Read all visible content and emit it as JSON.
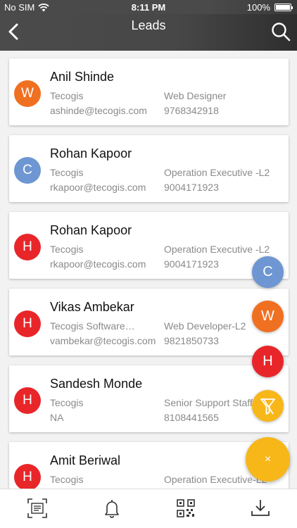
{
  "status_bar": {
    "carrier": "No SIM",
    "time": "8:11 PM",
    "battery": "100%"
  },
  "nav": {
    "title": "Leads",
    "back_icon": "chevron-left-icon",
    "search_icon": "search-icon"
  },
  "leads": [
    {
      "initial": "W",
      "color": "#f07022",
      "name": "Anil Shinde",
      "company": "Tecogis",
      "role": "Web Designer",
      "email": "ashinde@tecogis.com",
      "phone": "9768342918"
    },
    {
      "initial": "C",
      "color": "#6d96d2",
      "name": "Rohan Kapoor",
      "company": "Tecogis",
      "role": "Operation Executive -L2",
      "email": "rkapoor@tecogis.com",
      "phone": "9004171923"
    },
    {
      "initial": "H",
      "color": "#e8262a",
      "name": "Rohan Kapoor",
      "company": "Tecogis",
      "role": "Operation Executive -L2",
      "email": "rkapoor@tecogis.com",
      "phone": "9004171923"
    },
    {
      "initial": "H",
      "color": "#e8262a",
      "name": "Vikas Ambekar",
      "company": "Tecogis Software…",
      "role": "Web Developer-L2",
      "email": "vambekar@tecogis.com",
      "phone": "9821850733"
    },
    {
      "initial": "H",
      "color": "#e8262a",
      "name": "Sandesh Monde",
      "company": "Tecogis",
      "role": "Senior Support Staff",
      "email": "NA",
      "phone": "8108441565"
    },
    {
      "initial": "H",
      "color": "#e8262a",
      "name": "Amit Beriwal",
      "company": "Tecogis",
      "role": "Operation Executive-L2",
      "email": "",
      "phone": ""
    }
  ],
  "fab_menu": [
    {
      "label": "C",
      "color": "#6d96d2",
      "name": "filter-cold-button"
    },
    {
      "label": "W",
      "color": "#f07022",
      "name": "filter-warm-button"
    },
    {
      "label": "H",
      "color": "#e8262a",
      "name": "filter-hot-button"
    },
    {
      "label": "",
      "color": "#f7b719",
      "name": "filter-all-button",
      "icon": "funnel-icon"
    }
  ],
  "fab_main": {
    "label": "×",
    "color": "#f7b719"
  },
  "bottom_tabs": [
    {
      "name": "scan-card-tab",
      "icon": "card-scan-icon"
    },
    {
      "name": "notifications-tab",
      "icon": "bell-icon"
    },
    {
      "name": "qr-code-tab",
      "icon": "qr-code-icon"
    },
    {
      "name": "download-tab",
      "icon": "download-icon"
    }
  ]
}
